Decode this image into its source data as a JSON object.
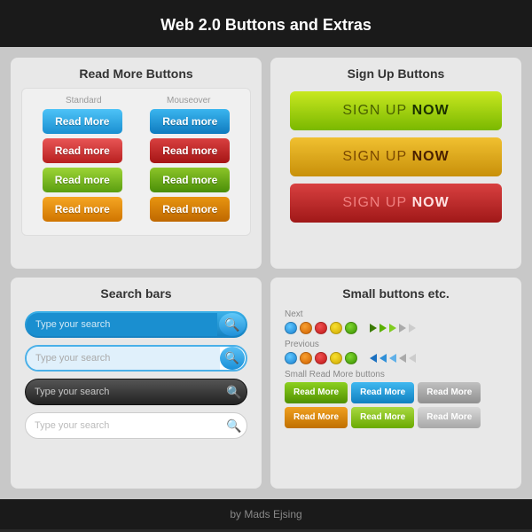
{
  "header": {
    "title": "Web 2.0 Buttons and Extras"
  },
  "panels": {
    "read_more": {
      "title": "Read More Buttons",
      "col_standard": "Standard",
      "col_mouseover": "Mouseover",
      "rows": [
        {
          "left": "Read More",
          "right": "Read more"
        },
        {
          "left": "Read more",
          "right": "Read more"
        },
        {
          "left": "Read more",
          "right": "Read more"
        },
        {
          "left": "Read more",
          "right": "Read more"
        }
      ]
    },
    "sign_up": {
      "title": "Sign Up Buttons",
      "buttons": [
        {
          "sign_up": "SIGN UP",
          "now": "NOW"
        },
        {
          "sign_up": "SIGN UP",
          "now": "NOW"
        },
        {
          "sign_up": "SIGN UP",
          "now": "NOW"
        }
      ]
    },
    "search_bars": {
      "title": "Search bars",
      "placeholder": "Type your search"
    },
    "small_buttons": {
      "title": "Small buttons etc.",
      "label_next": "Next",
      "label_previous": "Previous",
      "label_small_rm": "Small Read More buttons",
      "rm_buttons": [
        "Read More",
        "Read More",
        "Read More",
        "Read More",
        "Read More",
        "Read More"
      ]
    }
  },
  "footer": {
    "text": "by Mads Ejsing"
  }
}
